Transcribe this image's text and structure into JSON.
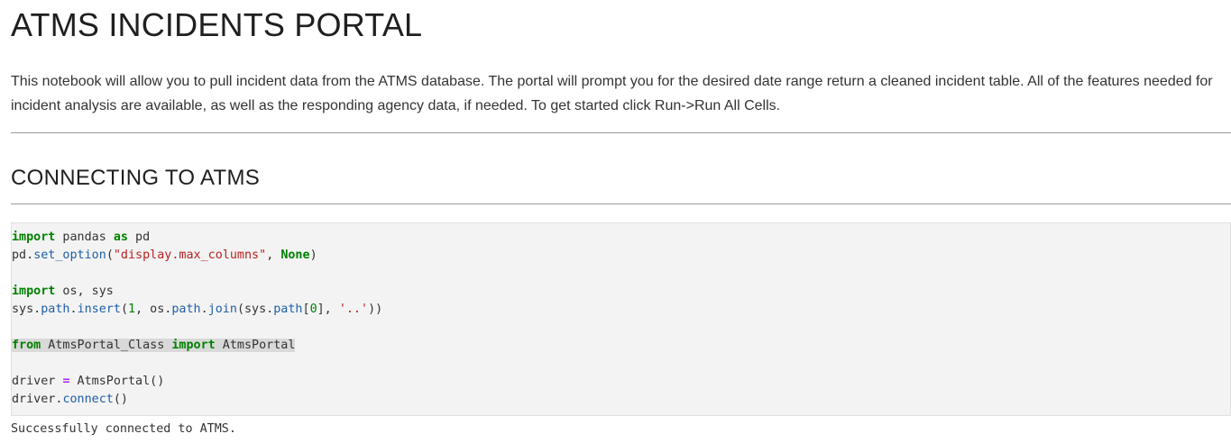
{
  "title": "ATMS INCIDENTS PORTAL",
  "intro": "This notebook will allow you to pull incident data from the ATMS database. The portal will prompt you for the desired date range return a cleaned incident table. All of the features needed for incident analysis are available, as well as the responding agency data, if needed. To get started click Run->Run All Cells.",
  "section_heading": "CONNECTING TO ATMS",
  "code": {
    "l1": {
      "kw1": "import",
      "t1": " pandas ",
      "kw2": "as",
      "t2": " pd"
    },
    "l2": {
      "t1": "pd.",
      "a1": "set_option",
      "t2": "(",
      "s1": "\"display.max_columns\"",
      "t3": ", ",
      "kw1": "None",
      "t4": ")"
    },
    "l4": {
      "kw1": "import",
      "t1": " os, sys"
    },
    "l5": {
      "t1": "sys.",
      "a1": "path",
      "t2": ".",
      "a2": "insert",
      "t3": "(",
      "n1": "1",
      "t4": ", os.",
      "a3": "path",
      "t5": ".",
      "a4": "join",
      "t6": "(sys.",
      "a5": "path",
      "t7": "[",
      "n2": "0",
      "t8": "], ",
      "s1": "'..'",
      "t9": "))"
    },
    "l7": {
      "kw1": "from",
      "t1": " AtmsPortal_Class ",
      "kw2": "import",
      "t2": " AtmsPortal"
    },
    "l9": {
      "t1": "driver ",
      "op": "=",
      "t2": " AtmsPortal()"
    },
    "l10": {
      "t1": "driver.",
      "a1": "connect",
      "t2": "()"
    }
  },
  "output": "Successfully connected to ATMS."
}
